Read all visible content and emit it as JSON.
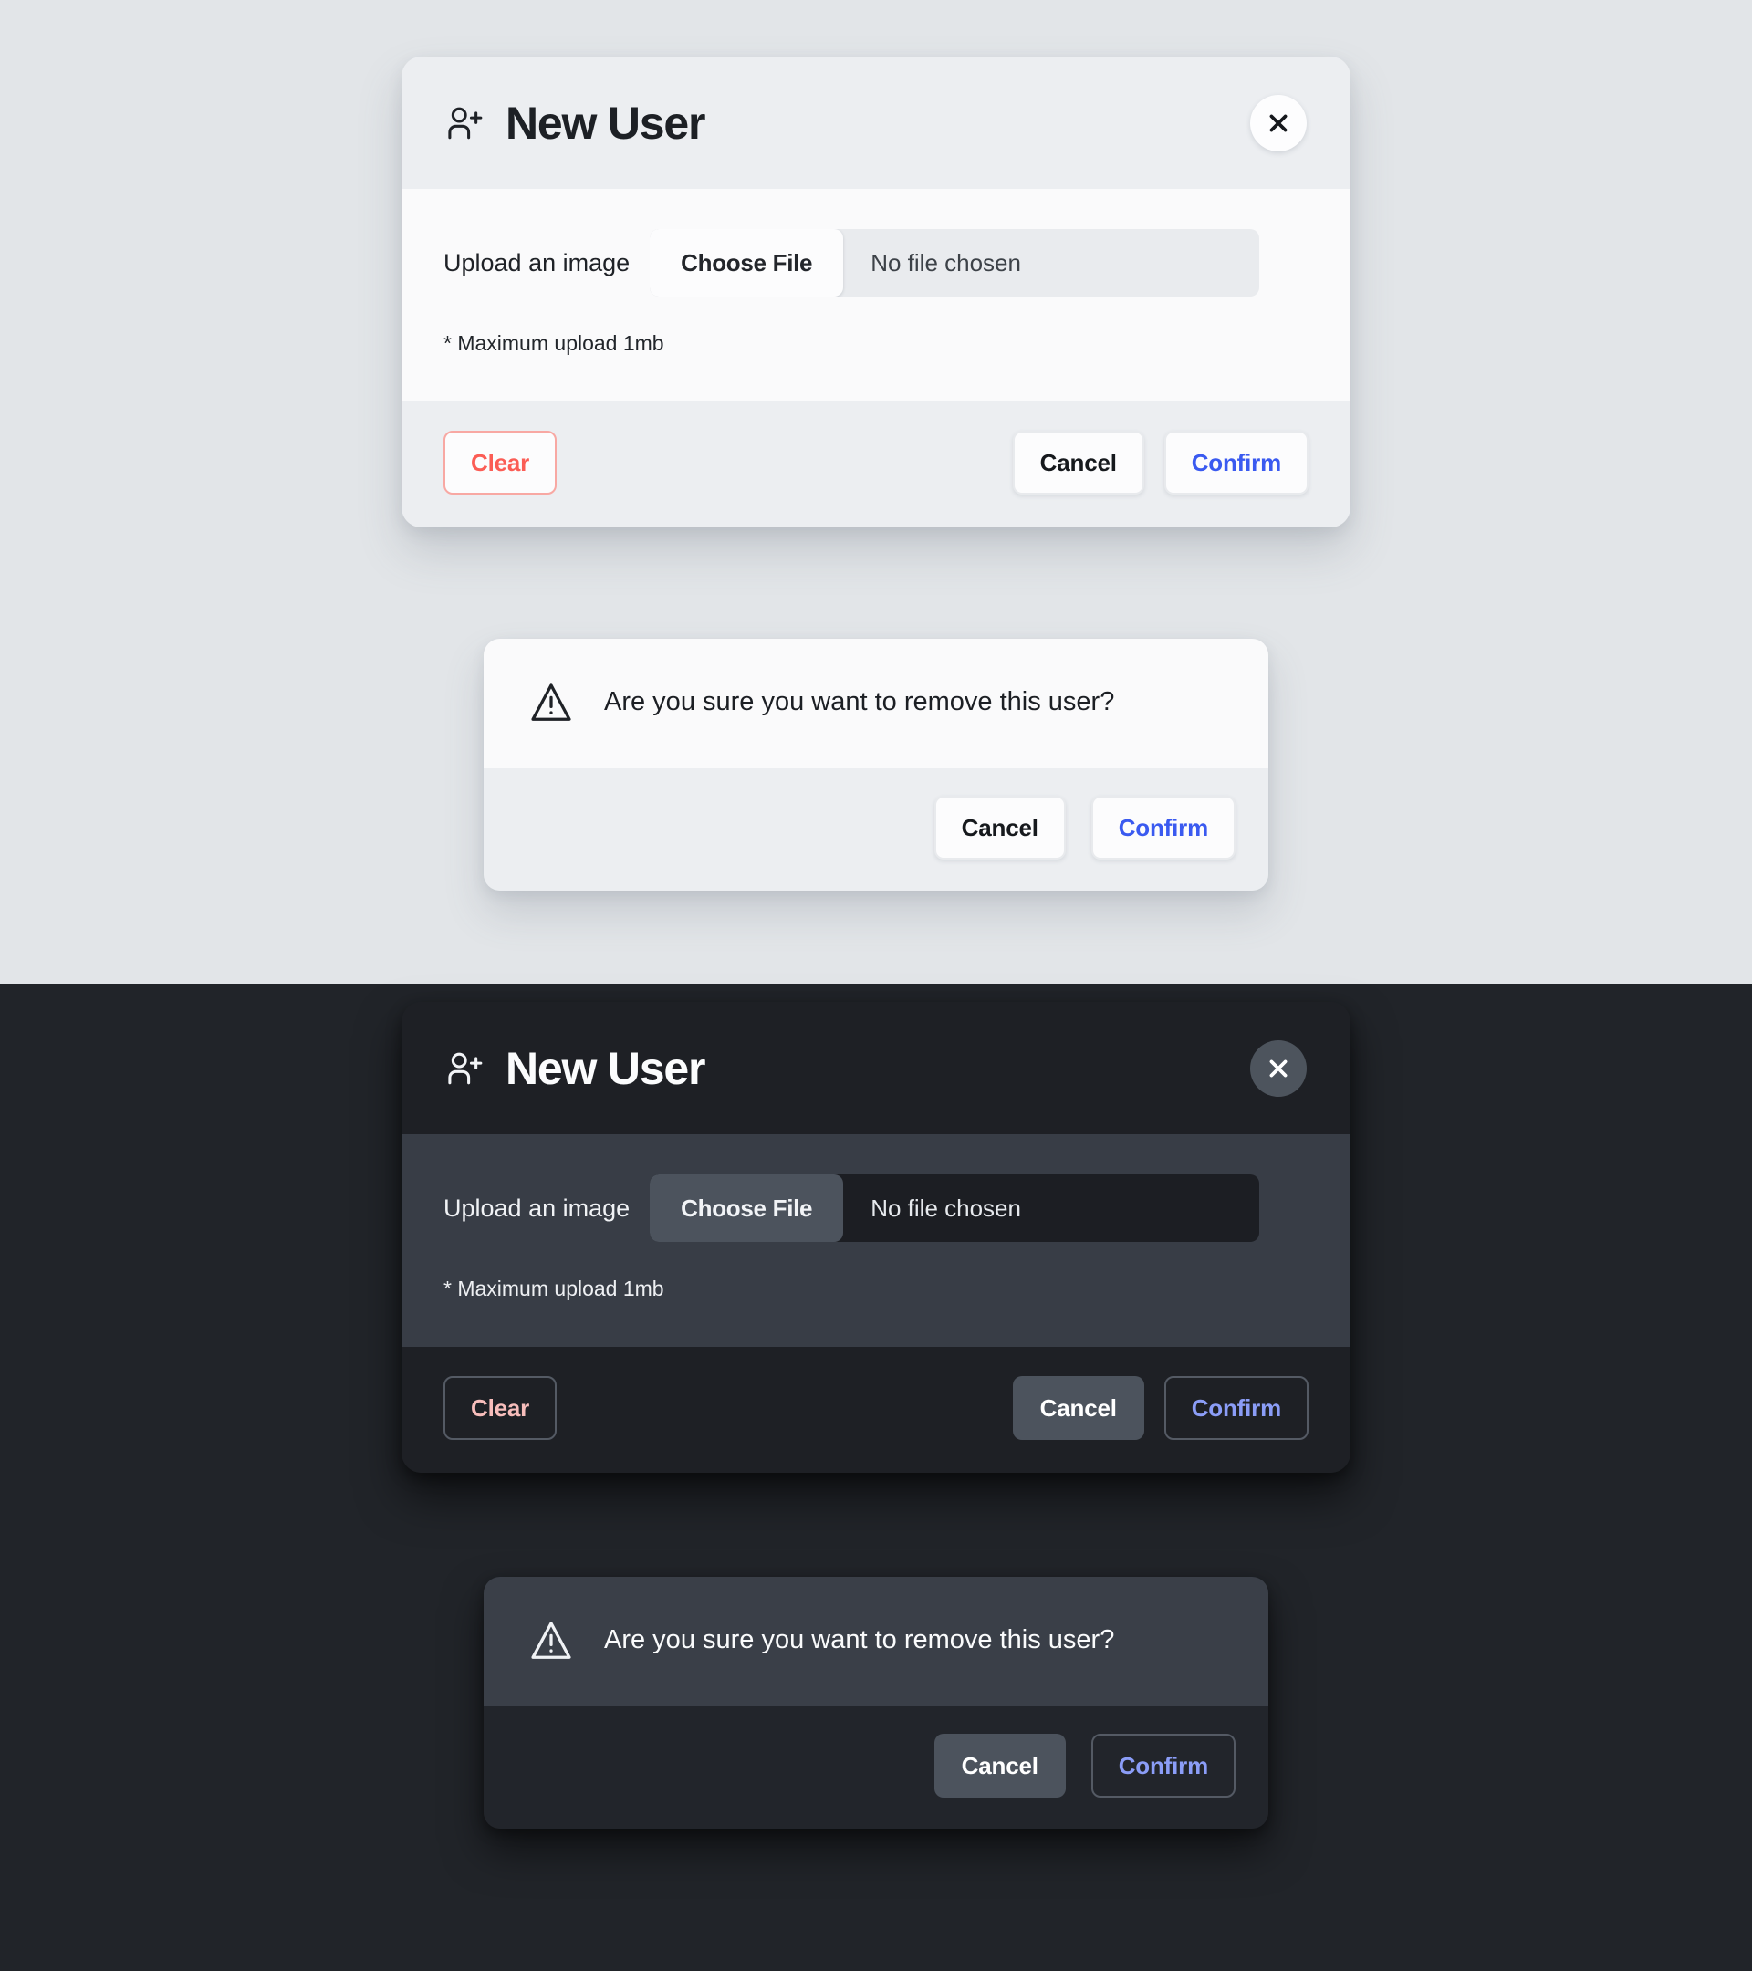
{
  "themes": {
    "light": {
      "background": "#e2e5e8",
      "accent_confirm": "#3a5af0",
      "accent_clear": "#fb5d55"
    },
    "dark": {
      "background": "#212429",
      "accent_confirm": "#8b9df7",
      "accent_clear": "#f7bdbb"
    }
  },
  "new_user_modal": {
    "title": "New User",
    "title_icon": "user-plus-icon",
    "close_icon": "close-icon",
    "upload": {
      "label": "Upload an image",
      "choose_file_label": "Choose File",
      "file_status": "No file chosen",
      "hint": "* Maximum upload 1mb"
    },
    "footer": {
      "clear_label": "Clear",
      "cancel_label": "Cancel",
      "confirm_label": "Confirm"
    }
  },
  "remove_user_dialog": {
    "icon": "warning-triangle-icon",
    "message": "Are you sure you want to remove this user?",
    "footer": {
      "cancel_label": "Cancel",
      "confirm_label": "Confirm"
    }
  }
}
